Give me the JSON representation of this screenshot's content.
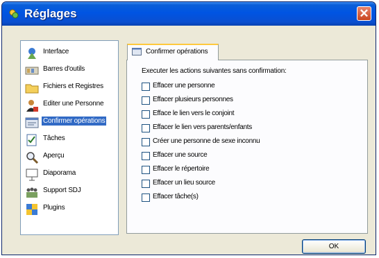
{
  "window": {
    "title": "Réglages"
  },
  "sidebar": {
    "items": [
      {
        "label": "Interface",
        "icon": "interface-icon"
      },
      {
        "label": "Barres d'outils",
        "icon": "toolbar-icon"
      },
      {
        "label": "Fichiers et Registres",
        "icon": "folder-icon"
      },
      {
        "label": "Editer une Personne",
        "icon": "person-icon"
      },
      {
        "label": "Confirmer opérations",
        "icon": "confirm-icon",
        "selected": true
      },
      {
        "label": "Tâches",
        "icon": "tasks-icon"
      },
      {
        "label": "Aperçu",
        "icon": "preview-icon"
      },
      {
        "label": "Diaporama",
        "icon": "slideshow-icon"
      },
      {
        "label": "Support SDJ",
        "icon": "support-icon"
      },
      {
        "label": "Plugins",
        "icon": "plugins-icon"
      }
    ]
  },
  "tab": {
    "label": "Confirmer opérations"
  },
  "panel": {
    "instruction": "Executer les actions suivantes sans confirmation:",
    "options": [
      {
        "label": "Effacer une personne",
        "checked": false
      },
      {
        "label": "Effacer plusieurs personnes",
        "checked": false
      },
      {
        "label": "Efface le lien vers le conjoint",
        "checked": false
      },
      {
        "label": "Effacer le lien vers parents/enfants",
        "checked": false
      },
      {
        "label": "Créer une personne de sexe inconnu",
        "checked": false
      },
      {
        "label": "Effacer une source",
        "checked": false
      },
      {
        "label": "Effacer le répertoire",
        "checked": false
      },
      {
        "label": "Effacer un lieu source",
        "checked": false
      },
      {
        "label": "Effacer tâche(s)",
        "checked": false
      }
    ]
  },
  "footer": {
    "ok_label": "OK"
  }
}
